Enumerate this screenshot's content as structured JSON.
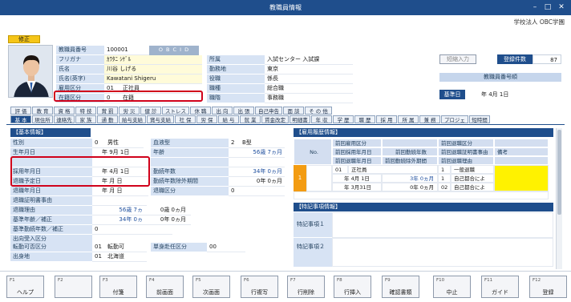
{
  "window": {
    "title": "教職員情報",
    "company": "学校法人 OBC学園"
  },
  "badge": "修正",
  "profile": {
    "rows": [
      {
        "label": "教職員番号",
        "value": "100001",
        "extra": "O B C I D"
      },
      {
        "label": "フリガナ",
        "value": "ｶﾜﾀﾆ ｼｹﾞﾙ"
      },
      {
        "label": "氏名",
        "value": "川谷 しげる"
      },
      {
        "label": "氏名(英字)",
        "value": "Kawatani Shigeru"
      },
      {
        "label": "雇用区分",
        "value": "01",
        "value2": "正社員"
      },
      {
        "label": "在籍区分",
        "value": "0",
        "value2": "在籍"
      }
    ],
    "org": [
      {
        "label": "所属",
        "value": "入試センター 入試課"
      },
      {
        "label": "勤務地",
        "value": "東京"
      },
      {
        "label": "役職",
        "value": "係長"
      },
      {
        "label": "職種",
        "value": "総合職"
      },
      {
        "label": "職階",
        "value": "事務職"
      }
    ]
  },
  "side": {
    "short_input": "短縮入力",
    "reg_count_label": "登録件数",
    "reg_count": "87",
    "staff_no_label": "教職員番号順",
    "base_date_label": "基準日",
    "base_date": "年 4月 1日"
  },
  "tabs_row1": [
    "評 価",
    "教 育",
    "資 格",
    "特 技",
    "賞 罰",
    "労 災",
    "健 診",
    "ストレス",
    "休 職",
    "出 向",
    "出 張",
    "自己申告",
    "面 談",
    "そ の 他"
  ],
  "tabs_row2": [
    "基 本",
    "現住所",
    "連絡先",
    "家 族",
    "通 勤",
    "給与支給",
    "賞与支給",
    "社 保",
    "労 保",
    "給 与",
    "就 業",
    "賃金改定",
    "明細書",
    "年 収",
    "学 歴",
    "職 歴",
    "採 用",
    "所 属",
    "兼 務",
    "プロジェ",
    "短時間"
  ],
  "basic": {
    "title": "【基本情報】",
    "gender_label": "性別",
    "gender_code": "0",
    "gender": "男性",
    "birth_label": "生年月日",
    "birth": "年 9月 1日",
    "blood_label": "血液型",
    "blood_code": "2",
    "blood": "B型",
    "age_label": "年齢",
    "age": "56歳 7ヵ月",
    "hire_label": "採用年月日",
    "hire": "年 4月 1日",
    "service_label": "勤続年数",
    "service": "34年 0ヵ月",
    "leave_plan_label": "退職予定日",
    "leave_plan": "年 月 日",
    "excluded_label": "勤続年数除外期間",
    "excluded": "0年 0ヵ月",
    "leave_label": "退職年月日",
    "leave": "年 月 日",
    "leave_type_label": "退職区分",
    "leave_type": "0",
    "cert_label": "退職証明書事由",
    "reason_label": "退職理由",
    "adj_age_label": "基準年齢／補正",
    "adj_age": "56歳 7ヵ月",
    "adj_age2": "0歳 0ヵ月",
    "adj_service_label": "基準勤続年数／補正",
    "adj_service": "34年 0ヵ月",
    "adj_service2": "0年 0ヵ月",
    "dispatch_label": "出向受入区分",
    "dispatch": "0",
    "transfer_label": "転勤可否区分",
    "transfer_code": "01",
    "transfer": "転勤可",
    "single_label": "単身赴任区分",
    "single": "00",
    "origin_label": "出身地",
    "origin_code": "01",
    "origin": "北海道"
  },
  "history": {
    "title": "【雇用履歴情報】",
    "headers": {
      "no": "No.",
      "prev_type": "前回雇用区分",
      "prev_leave_type": "前回退職区分",
      "prev_hire": "前回採用年月日",
      "prev_service": "前回勤続年数",
      "prev_cert": "前回退職証明書事由",
      "prev_leave": "前回退職年月日",
      "prev_excluded": "前回勤続除外期間",
      "prev_reason": "前回退職理由",
      "note": "備考"
    },
    "row": {
      "no": "1",
      "type_code": "01",
      "type": "正社員",
      "hire": "年 4月 1日",
      "leave": "年 3月31日",
      "service": "3年 0ヵ月",
      "excluded": "0年 0ヵ月",
      "leave_type_code": "1",
      "leave_type": "一般退職",
      "cert_code": "1",
      "cert": "自己都合によ",
      "reason_code": "02",
      "reason": "自己都合によ"
    }
  },
  "notes": {
    "title": "【特記事項情報】",
    "item1": "特記事項１",
    "item2": "特記事項２"
  },
  "fkeys": [
    {
      "key": "F1",
      "label": "ヘルプ"
    },
    {
      "key": "F2",
      "label": ""
    },
    {
      "key": "F3",
      "label": "付箋"
    },
    {
      "key": "F4",
      "label": "前画面"
    },
    {
      "key": "F5",
      "label": "次画面"
    },
    {
      "key": "F6",
      "label": "行複写"
    },
    {
      "key": "F7",
      "label": "行削除"
    },
    {
      "key": "F8",
      "label": "行挿入"
    },
    {
      "key": "F9",
      "label": "確認書類"
    },
    {
      "key": "F10",
      "label": "中止"
    },
    {
      "key": "F11",
      "label": "ガイド"
    },
    {
      "key": "F12",
      "label": "登録"
    }
  ],
  "colors": {
    "titlebar": "#1f4e8c",
    "highlight": "#d0021b",
    "badge": "#f5c518",
    "note_yellow": "#fff200",
    "row_orange": "#f39c12"
  }
}
